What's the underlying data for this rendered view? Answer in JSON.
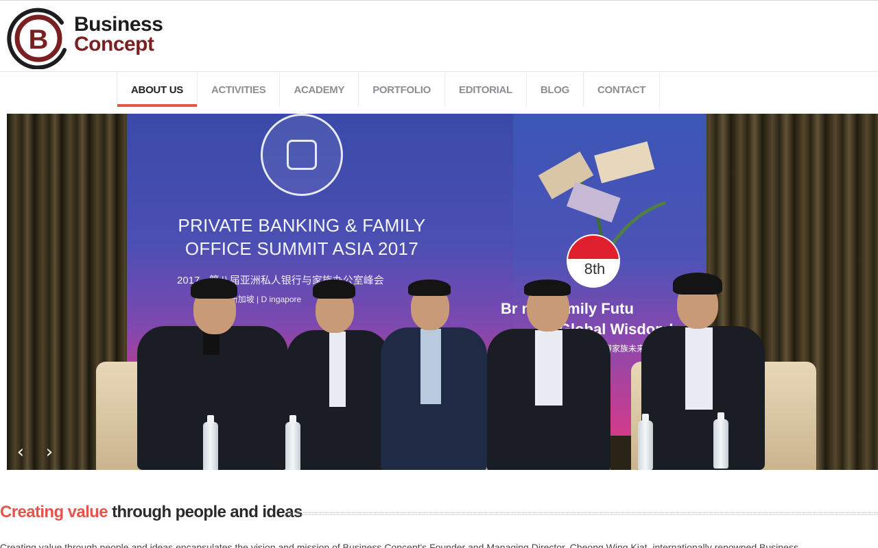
{
  "brand": {
    "line1": "Business",
    "line2": "Concept",
    "monogram": "B",
    "colors": {
      "dark": "#1d1d1d",
      "maroon": "#7a1f22"
    }
  },
  "nav": {
    "items": [
      {
        "label": "ABOUT US",
        "active": true
      },
      {
        "label": "ACTIVITIES",
        "active": false
      },
      {
        "label": "ACADEMY",
        "active": false
      },
      {
        "label": "PORTFOLIO",
        "active": false
      },
      {
        "label": "EDITORIAL",
        "active": false
      },
      {
        "label": "BLOG",
        "active": false
      },
      {
        "label": "CONTACT",
        "active": false
      }
    ],
    "active_color": "#e5534b"
  },
  "hero": {
    "banner_title": "PRIVATE BANKING & FAMILY OFFICE SUMMIT ASIA 2017",
    "banner_subtitle": "2017 · 第八届亚洲私人银行与家族办公室峰会",
    "banner_date": "/12/01 新加坡 | D    ingapore",
    "edition": "8th",
    "tagline_1": "Br    n A Family Futu",
    "tagline_2": "W  Global Wisdom!",
    "tagline_3": "思辨家族未来",
    "prev_icon": "chevron-left-icon",
    "next_icon": "chevron-right-icon"
  },
  "section": {
    "heading_accent": "Creating value",
    "heading_rest": " through people and ideas",
    "intro": "Creating value through people and ideas encapsulates the vision and mission of Business Concept's Founder and Managing Director, Cheong Wing Kiat, internationally renowned Business"
  }
}
